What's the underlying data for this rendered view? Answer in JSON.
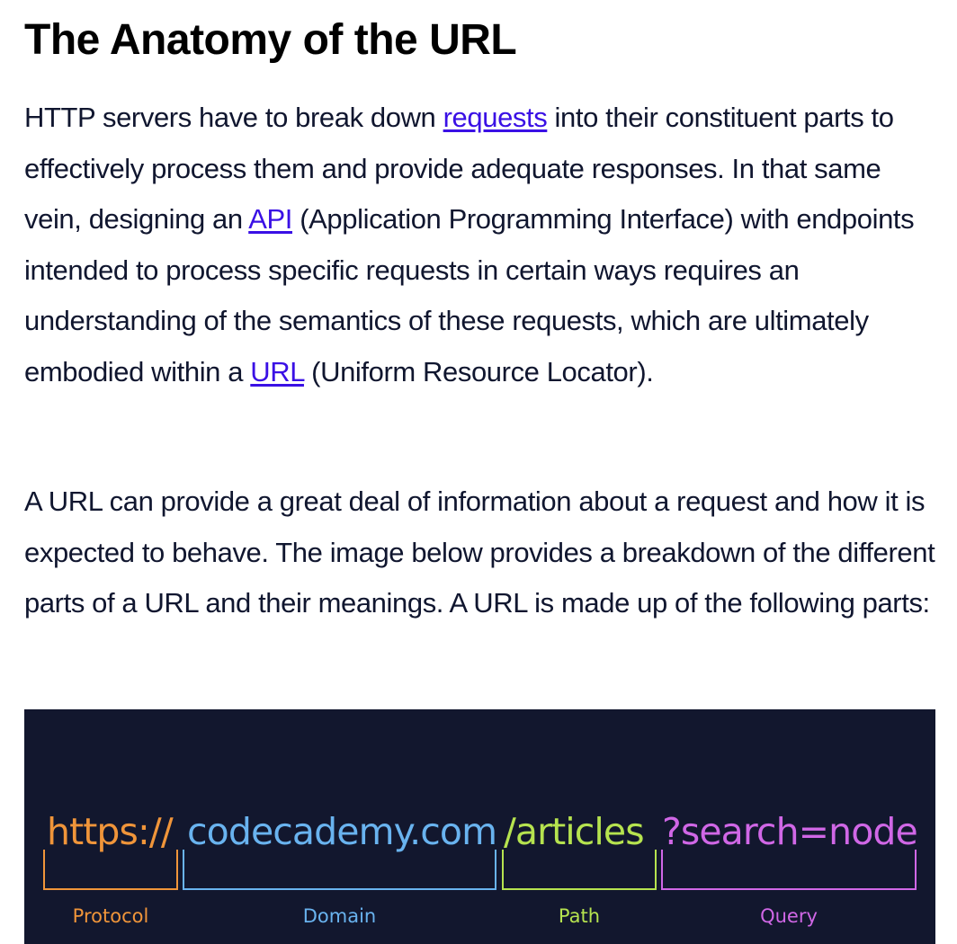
{
  "article": {
    "title": "The Anatomy of the URL",
    "paragraph1": {
      "t1": "HTTP servers have to break down ",
      "link_requests": "requests",
      "t2": " into their constituent parts to effectively process them and provide adequate responses. In that same vein, designing an ",
      "link_api": "API",
      "t3": " (Application Programming Interface) with endpoints intended to process specific requests in certain ways requires an understanding of the semantics of these requests, which are ultimately embodied within a ",
      "link_url": "URL",
      "t4": " (Uniform Resource Locator)."
    },
    "paragraph2": "A URL can provide a great deal of information about a request and how it is expected to behave. The image below provides a breakdown of the different parts of a URL and their meanings. A URL is made up of the following parts:"
  },
  "figure": {
    "background": "#12172e",
    "segments": [
      {
        "text": "https://",
        "label": "Protocol",
        "color": "#f0953a"
      },
      {
        "text": "codecademy.com",
        "label": "Domain",
        "color": "#69b3ef"
      },
      {
        "text": "/articles",
        "label": "Path",
        "color": "#b6e34f"
      },
      {
        "text": "?search=node",
        "label": "Query",
        "color": "#d067e6"
      }
    ]
  },
  "colors": {
    "text": "#10162f",
    "link": "#3a10e5",
    "heading": "#000000"
  }
}
